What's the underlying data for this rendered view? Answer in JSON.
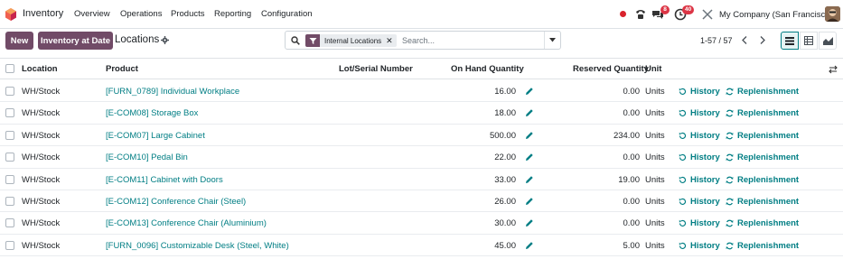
{
  "navbar": {
    "app_name": "Inventory",
    "menus": [
      "Overview",
      "Operations",
      "Products",
      "Reporting",
      "Configuration"
    ],
    "messages_badge": "8",
    "activities_badge": "40",
    "company": "My Company (San Francisco)"
  },
  "control": {
    "new_label": "New",
    "inventory_at_date_label": "Inventory at Date",
    "breadcrumb": "Locations",
    "facet_label": "Internal Locations",
    "search_placeholder": "Search...",
    "pager": "1-57 / 57"
  },
  "table": {
    "headers": {
      "location": "Location",
      "product": "Product",
      "lot": "Lot/Serial Number",
      "on_hand": "On Hand Quantity",
      "reserved": "Reserved Quantity",
      "unit": "Unit"
    },
    "history_label": "History",
    "replenishment_label": "Replenishment",
    "rows": [
      {
        "location": "WH/Stock",
        "product": "[FURN_0789] Individual Workplace",
        "on_hand": "16.00",
        "reserved": "0.00",
        "unit": "Units"
      },
      {
        "location": "WH/Stock",
        "product": "[E-COM08] Storage Box",
        "on_hand": "18.00",
        "reserved": "0.00",
        "unit": "Units"
      },
      {
        "location": "WH/Stock",
        "product": "[E-COM07] Large Cabinet",
        "on_hand": "500.00",
        "reserved": "234.00",
        "unit": "Units"
      },
      {
        "location": "WH/Stock",
        "product": "[E-COM10] Pedal Bin",
        "on_hand": "22.00",
        "reserved": "0.00",
        "unit": "Units"
      },
      {
        "location": "WH/Stock",
        "product": "[E-COM11] Cabinet with Doors",
        "on_hand": "33.00",
        "reserved": "19.00",
        "unit": "Units"
      },
      {
        "location": "WH/Stock",
        "product": "[E-COM12] Conference Chair (Steel)",
        "on_hand": "26.00",
        "reserved": "0.00",
        "unit": "Units"
      },
      {
        "location": "WH/Stock",
        "product": "[E-COM13] Conference Chair (Aluminium)",
        "on_hand": "30.00",
        "reserved": "0.00",
        "unit": "Units"
      },
      {
        "location": "WH/Stock",
        "product": "[FURN_0096] Customizable Desk (Steel, White)",
        "on_hand": "45.00",
        "reserved": "5.00",
        "unit": "Units"
      }
    ]
  },
  "colors": {
    "brand": "#714b67",
    "link": "#017e84",
    "badge": "#dc3545"
  }
}
